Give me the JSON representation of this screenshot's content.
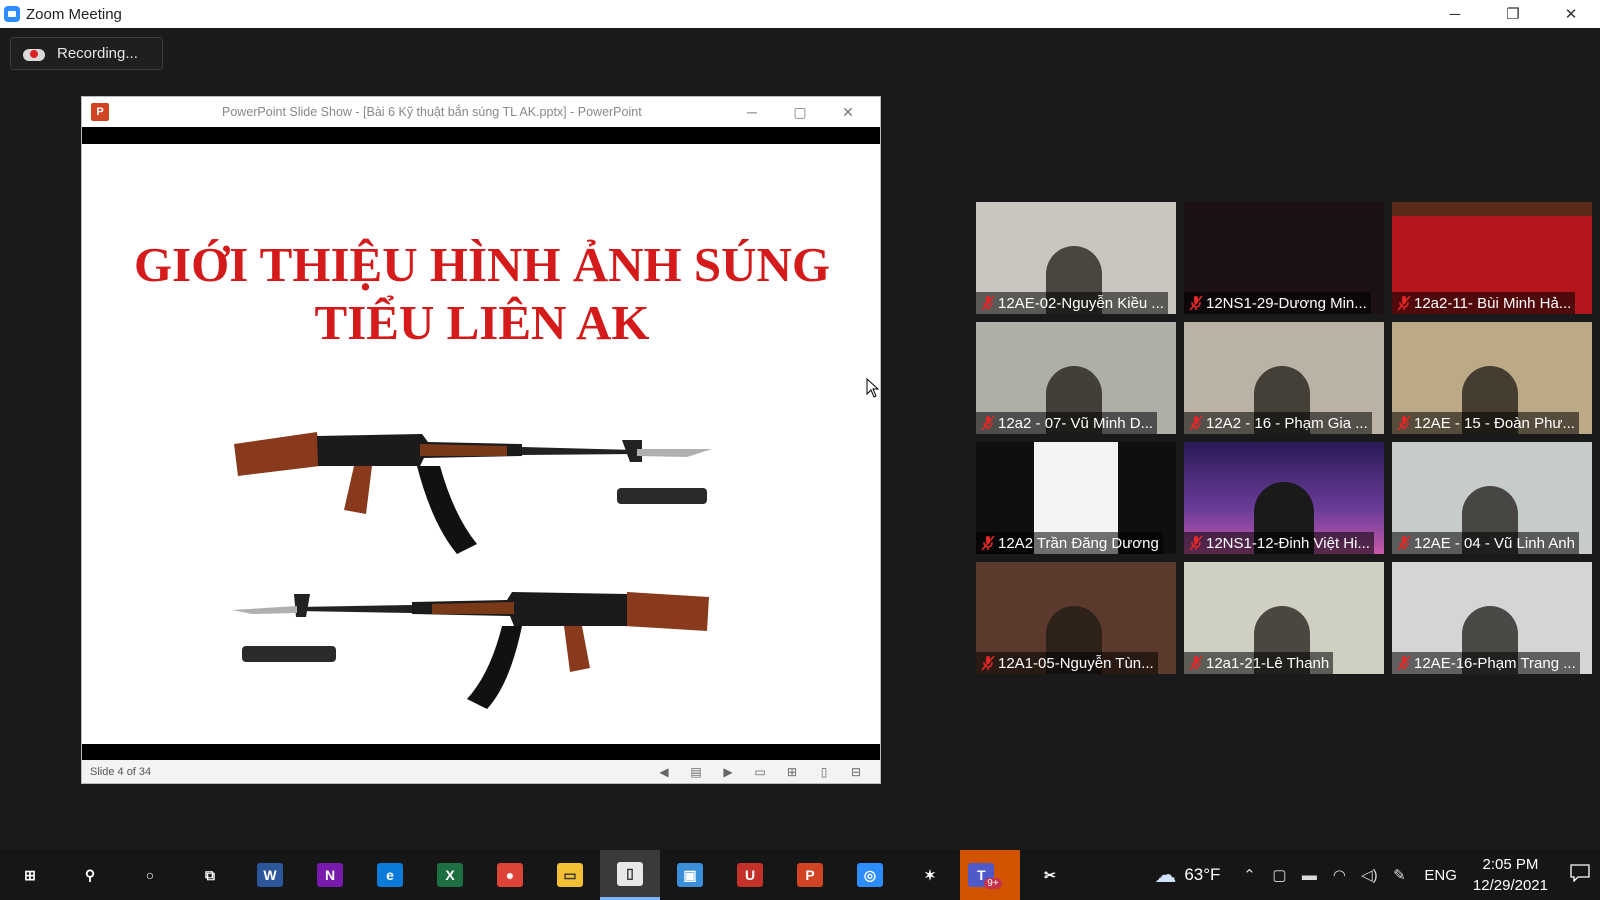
{
  "window": {
    "title": "Zoom Meeting",
    "minimize": "─",
    "restore": "❐",
    "close": "✕"
  },
  "recording": {
    "label": "Recording..."
  },
  "powerpoint": {
    "logo": "P",
    "title": "PowerPoint Slide Show - [Bài 6 Kỹ thuật bắn súng TL AK.pptx] - PowerPoint",
    "slide_title_line1": "GIỚI THIỆU HÌNH ẢNH SÚNG",
    "slide_title_line2": "TIỂU LIÊN AK",
    "slide_counter": "Slide 4 of 34",
    "tools": [
      "◀",
      "▤",
      "▶",
      "▭",
      "⊞",
      "▯",
      "⊟"
    ]
  },
  "participants": [
    {
      "name": "12AE-02-Nguyễn Kiều ...",
      "bg": "#c9c6bf",
      "icon": "room-wall"
    },
    {
      "name": "12NS1-29-Dương Min...",
      "bg": "#1c1214",
      "icon": "dark-video"
    },
    {
      "name": "12a2-11- Bùi Minh Hả...",
      "bg": "#b4171b",
      "icon": "red-background"
    },
    {
      "name": "12a2 - 07- Vũ Minh D...",
      "bg": "#aeb0a8",
      "icon": "room-video"
    },
    {
      "name": "12A2 - 16 - Phạm Gia ...",
      "bg": "#b9b2a5",
      "icon": "room-video"
    },
    {
      "name": "12AE - 15 - Đoàn Phư...",
      "bg": "#bca985",
      "icon": "room-video"
    },
    {
      "name": "12A2 Trần Đăng Dương",
      "bg": "#0f0f0f",
      "icon": "narrow-video"
    },
    {
      "name": "12NS1-12-Đinh Việt Hi...",
      "bg": "#4b2c74",
      "icon": "city-background"
    },
    {
      "name": "12AE - 04 - Vũ Linh Anh",
      "bg": "#c6ccc9",
      "icon": "room-video"
    },
    {
      "name": "12A1-05-Nguyễn Tùn...",
      "bg": "#5b3a2d",
      "icon": "room-video"
    },
    {
      "name": "12a1-21-Lê Thanh",
      "bg": "#cfcfc2",
      "icon": "ceiling-video"
    },
    {
      "name": "12AE-16-Phạm Trang ...",
      "bg": "#d4d6d5",
      "icon": "blinds-video"
    }
  ],
  "taskbar": {
    "apps": [
      {
        "name": "windows-start",
        "label": "⊞",
        "bg": "transparent"
      },
      {
        "name": "search",
        "label": "⚲",
        "bg": "transparent"
      },
      {
        "name": "cortana",
        "label": "○",
        "bg": "transparent"
      },
      {
        "name": "task-view",
        "label": "⧉",
        "bg": "transparent"
      },
      {
        "name": "word",
        "label": "W",
        "bg": "#2b579a"
      },
      {
        "name": "onenote",
        "label": "N",
        "bg": "#7719aa"
      },
      {
        "name": "edge",
        "label": "e",
        "bg": "#0c7ad8"
      },
      {
        "name": "excel",
        "label": "X",
        "bg": "#1d6f42"
      },
      {
        "name": "chrome",
        "label": "●",
        "bg": "#db4437"
      },
      {
        "name": "file-explorer",
        "label": "▭",
        "bg": "#f3c035"
      },
      {
        "name": "notepad",
        "label": "▯",
        "bg": "#e8e8e8"
      },
      {
        "name": "photos",
        "label": "▣",
        "bg": "#3b8ed8"
      },
      {
        "name": "unikey",
        "label": "U",
        "bg": "#c4312b"
      },
      {
        "name": "powerpoint",
        "label": "P",
        "bg": "#d04423"
      },
      {
        "name": "zoom",
        "label": "◎",
        "bg": "#2d8cff"
      },
      {
        "name": "system-app",
        "label": "✶",
        "bg": "transparent"
      },
      {
        "name": "teams",
        "label": "T",
        "bg": "#5059c9"
      },
      {
        "name": "snipping-tool",
        "label": "✂",
        "bg": "transparent"
      }
    ],
    "teams_badge": "9+",
    "weather": "63°F",
    "lang": "ENG",
    "time": "2:05 PM",
    "date": "12/29/2021"
  }
}
